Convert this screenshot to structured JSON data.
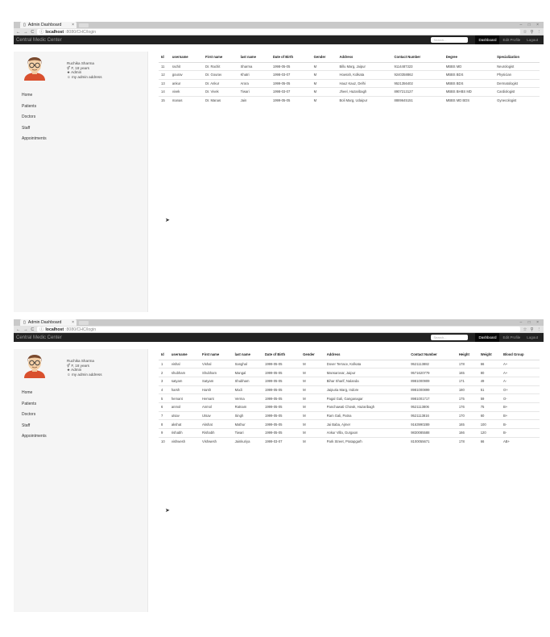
{
  "browser": {
    "tab_title": "Admin Dashboard",
    "url_host": "localhost",
    "url_path": ":8080/CHC/login"
  },
  "navbar": {
    "brand": "Central Medic Center",
    "search_placeholder": "Search...",
    "links": [
      "Dashboard",
      "Edit Profile",
      "Logout"
    ]
  },
  "profile": {
    "name": "Ruchika Sharma",
    "age": "F, 18 years",
    "role": "Admin",
    "address": "my admin address"
  },
  "menu": [
    "Home",
    "Patients",
    "Doctors",
    "Staff",
    "Appointments"
  ],
  "doctors_table": {
    "headers": [
      "Id",
      "username",
      "First name",
      "last name",
      "Date of Birth",
      "Gender",
      "Address",
      "Contact Number",
      "Degree",
      "Specialization"
    ],
    "rows": [
      [
        "11",
        "rachit",
        "Dr. Rachit",
        "Sharma",
        "1998-05-05",
        "M",
        "Billu Marg, Jaipur",
        "9114487323",
        "MBBS MD",
        "Neurologist"
      ],
      [
        "12",
        "gourav",
        "Dr. Gourav",
        "Khatri",
        "1998-03-07",
        "M",
        "Howrah, Kolkata",
        "9240358862",
        "MBBS BDS",
        "Physician"
      ],
      [
        "13",
        "ankur",
        "Dr. Ankur",
        "Arora",
        "1999-05-05",
        "M",
        "Hauz Kauz, Delhi",
        "9521356402",
        "MBBS BDS",
        "Dermatologist"
      ],
      [
        "14",
        "vivek",
        "Dr. Vivek",
        "Tiwari",
        "1998-03-07",
        "M",
        "Jheel, Hazaribagh",
        "8907213127",
        "MBBS BHBS MD",
        "Cardiologist"
      ],
      [
        "15",
        "manas",
        "Dr. Manas",
        "Jain",
        "1999-05-05",
        "M",
        "Boli Marg, Udaipur",
        "8889645151",
        "MBBS MD BDS",
        "Gynecologist"
      ]
    ]
  },
  "patients_table": {
    "headers": [
      "Id",
      "username",
      "First name",
      "last name",
      "Date of Birth",
      "Gender",
      "Address",
      "Contact Number",
      "Height",
      "Weight",
      "Blood Group"
    ],
    "rows": [
      [
        "1",
        "vishal",
        "Vishal",
        "Sanghal",
        "1999-05-05",
        "M",
        "Dover Terrace, Kolkata",
        "9521113882",
        "178",
        "66",
        "A+"
      ],
      [
        "2",
        "shubham",
        "Shubham",
        "Mangal",
        "1999-05-05",
        "M",
        "Mansarovar, Jaipur",
        "9571620779",
        "165",
        "80",
        "A+"
      ],
      [
        "3",
        "satyam",
        "Satyam",
        "Shubham",
        "1999-05-05",
        "M",
        "Bihar Sharif, Nalanda",
        "8981000909",
        "171",
        "49",
        "A-"
      ],
      [
        "4",
        "harsh",
        "Harsh",
        "Modi",
        "1999-05-05",
        "M",
        "Jaipuria Marg, Indore",
        "8981000899",
        "180",
        "51",
        "O+"
      ],
      [
        "5",
        "hemant",
        "Hemant",
        "Verma",
        "1999-05-05",
        "M",
        "Pagal Gali, Ganganagar",
        "8981001717",
        "175",
        "59",
        "O-"
      ],
      [
        "6",
        "anmol",
        "Anmol",
        "Ratnam",
        "1999-05-05",
        "M",
        "Panchawati Chowk, Hazaribagh",
        "9521113806",
        "176",
        "75",
        "B+"
      ],
      [
        "7",
        "utsav",
        "Utsav",
        "Singh",
        "1999-05-05",
        "M",
        "Ram Gali, Patna",
        "9521113816",
        "170",
        "60",
        "B+"
      ],
      [
        "8",
        "akshat",
        "Akshat",
        "Mathur",
        "1999-05-05",
        "M",
        "Jai Baba, Ajmer",
        "9163990289",
        "165",
        "100",
        "B-"
      ],
      [
        "9",
        "rishabh",
        "Rishabh",
        "Tiwari",
        "1999-05-05",
        "M",
        "Ankur Villa, Gurgaon",
        "9830085588",
        "166",
        "120",
        "B-"
      ],
      [
        "10",
        "vishwesh",
        "Vishwesh",
        "Jainkuriya",
        "1999-03-07",
        "M",
        "Park Street, Pratapgarh",
        "8100055671",
        "178",
        "66",
        "AB+"
      ]
    ]
  },
  "colors": {
    "navbar_bg": "#222222",
    "navbar_text": "#9d9d9d",
    "navbar_active_bg": "#080808",
    "sidebar_bg": "#f5f5f5"
  }
}
